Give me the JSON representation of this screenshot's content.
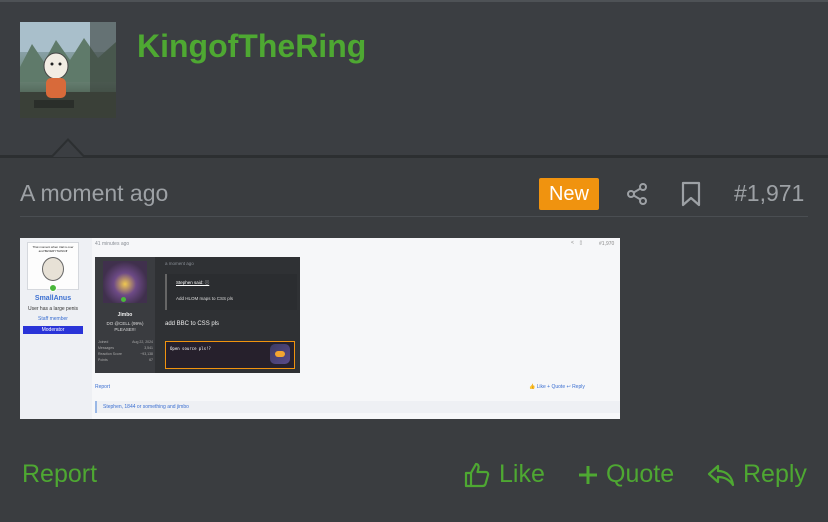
{
  "header": {
    "username": "KingofTheRing"
  },
  "post": {
    "time": "A moment ago",
    "badge": "New",
    "number": "#1,971"
  },
  "screenshot": {
    "time": "41 minutes ago",
    "post_number": "#1,970",
    "user": {
      "avatar_caption": "That moment when trial is over and ♥EVERYTHING♥",
      "name": "SmallAnus",
      "subtitle": "User has a large penis",
      "role": "Staff member",
      "badge": "Moderator"
    },
    "quoted_post": {
      "time": "a moment ago",
      "user_name": "Jimbo",
      "user_line1": "DO @CELL (99%)",
      "user_line2": "PLEASE!!!",
      "stats": [
        {
          "label": "Joined",
          "value": "Aug 22, 2024"
        },
        {
          "label": "Messages",
          "value": "3,541"
        },
        {
          "label": "Reaction Score",
          "value": "~93,138"
        },
        {
          "label": "Points",
          "value": "67"
        }
      ],
      "quote_author": "Stephen said: ⓘ",
      "quote_text": "Add HLOM maps to CSS pls",
      "body": "add BBC to CSS pls",
      "code_text": "Open source pls!?"
    },
    "report": "Report",
    "actions": "👍 Like  + Quote  ↩ Reply",
    "reactions": "Stephen, 1844 or something and jimbo"
  },
  "footer": {
    "report": "Report",
    "like": "Like",
    "quote": "Quote",
    "reply": "Reply"
  },
  "colors": {
    "accent_green": "#4ea832",
    "badge_orange": "#f0930f",
    "background": "#3a3d40"
  }
}
